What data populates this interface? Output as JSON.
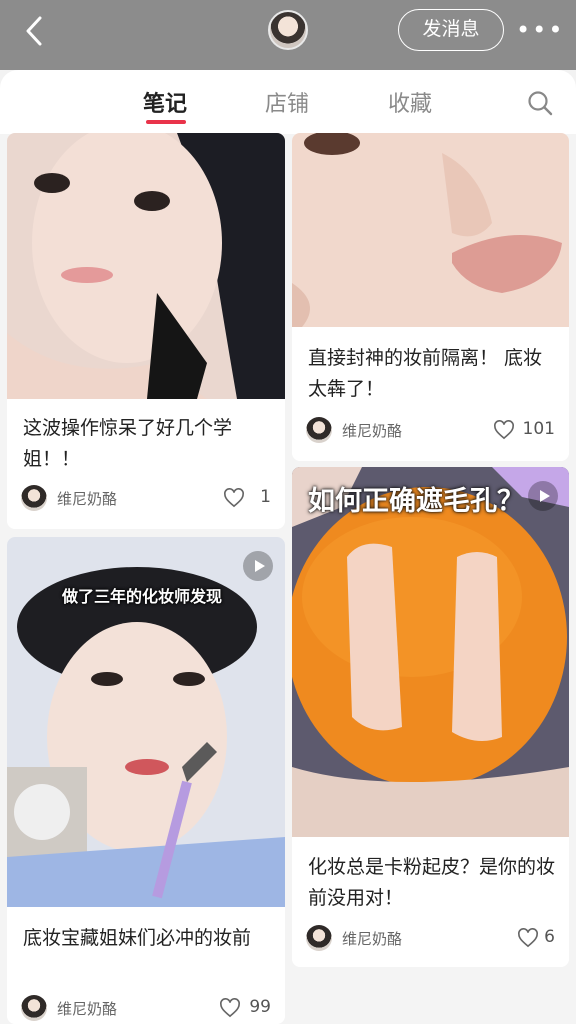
{
  "header": {
    "send_message_label": "发消息",
    "more_label": "•••"
  },
  "tabs": [
    {
      "label": "笔记",
      "active": true
    },
    {
      "label": "店铺",
      "active": false
    },
    {
      "label": "收藏",
      "active": false
    }
  ],
  "notes": [
    {
      "title": "这波操作惊呆了好几个学姐！！",
      "author": "维尼奶酪",
      "likes": "1",
      "is_video": false
    },
    {
      "title": "直接封神的妆前隔离！ 底妆太犇了！",
      "author": "维尼奶酪",
      "likes": "101",
      "is_video": false
    },
    {
      "title": "底妆宝藏姐妹们必冲的妆前",
      "author": "维尼奶酪",
      "likes": "99",
      "is_video": true,
      "overlay": "做了三年的化妆师发现"
    },
    {
      "title": "化妆总是卡粉起皮？是你的妆前没用对！",
      "author": "维尼奶酪",
      "likes": "6",
      "is_video": true,
      "overlay": "如何正确遮毛孔？"
    }
  ],
  "colors": {
    "accent": "#e9334a",
    "header_bg": "#8c8c8c"
  },
  "icons": [
    "back-icon",
    "more-icon",
    "search-icon",
    "heart-icon",
    "play-icon"
  ]
}
